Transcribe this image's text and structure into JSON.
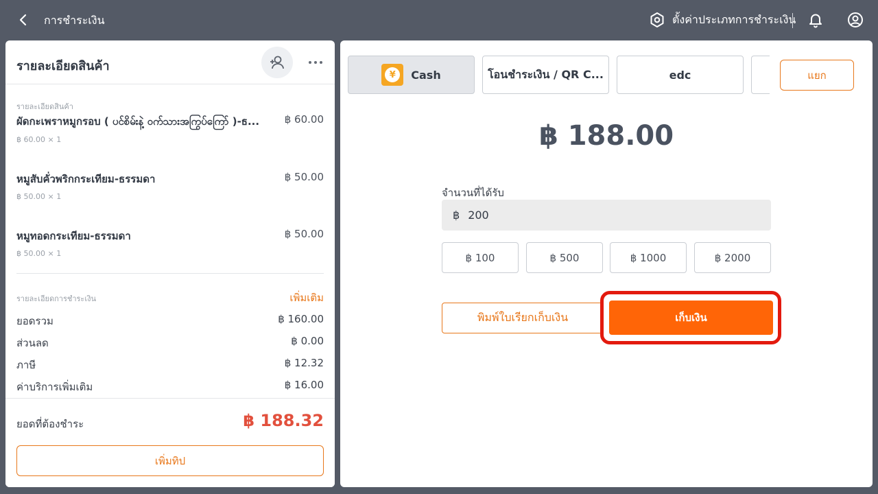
{
  "topbar": {
    "title": "การชำระเงิน",
    "settings_label": "ตั้งค่าประเภทการชำระเงิน"
  },
  "order": {
    "title": "รายละเอียดสินค้า",
    "section_label": "รายละเอียดสินค้า",
    "items": [
      {
        "name": "ผัดกะเพราหมูกรอบ ( ပင်စိမ်းနဲ့ ဝက်သားအကြွပ်ကြော် )-ธ...",
        "price": "฿ 60.00",
        "qty": "฿ 60.00 × 1"
      },
      {
        "name": "หมูสับคั่วพริกกระเทียม-ธรรมดา",
        "price": "฿ 50.00",
        "qty": "฿ 50.00 × 1"
      },
      {
        "name": "หมูทอดกระเทียม-ธรรมดา",
        "price": "฿ 50.00",
        "qty": "฿ 50.00 × 1"
      }
    ],
    "payment_section_label": "รายละเอียดการชำระเงิน",
    "add_more": "เพิ่มเติม",
    "summary": [
      {
        "label": "ยอดรวม",
        "value": "฿ 160.00"
      },
      {
        "label": "ส่วนลด",
        "value": "฿ 0.00"
      },
      {
        "label": "ภาษี",
        "value": "฿ 12.32"
      },
      {
        "label": "ค่าบริการเพิ่มเติม",
        "value": "฿ 16.00"
      }
    ],
    "due_label": "ยอดที่ต้องชำระ",
    "due_value": "฿ 188.32",
    "tip_button": "เพิ่มทิป"
  },
  "payment": {
    "tabs": [
      {
        "label": "Cash",
        "active": true
      },
      {
        "label": "โอนชำระเงิน / QR C...",
        "active": false
      },
      {
        "label": "edc",
        "active": false
      }
    ],
    "split_button": "แยก",
    "amount": "฿ 188.00",
    "received_label": "จำนวนที่ได้รับ",
    "received_currency": "฿",
    "received_value": "200",
    "quick_amounts": [
      "฿ 100",
      "฿ 500",
      "฿ 1000",
      "฿ 2000"
    ],
    "print_button": "พิมพ์ใบเรียกเก็บเงิน",
    "collect_button": "เก็บเงิน",
    "colors": {
      "accent": "#ff6507",
      "highlight": "#e31a0e",
      "cash_icon": "#f5a623"
    }
  }
}
